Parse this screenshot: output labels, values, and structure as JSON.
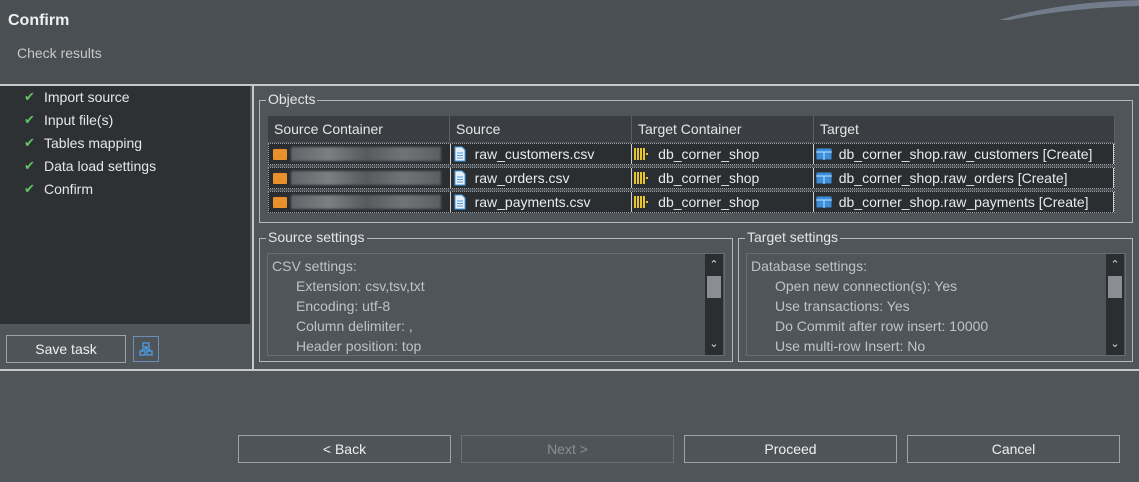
{
  "header": {
    "title": "Confirm",
    "subtitle": "Check results"
  },
  "sidebar": {
    "steps": [
      {
        "label": "Import source"
      },
      {
        "label": "Input file(s)"
      },
      {
        "label": "Tables mapping"
      },
      {
        "label": "Data load settings"
      },
      {
        "label": "Confirm"
      }
    ],
    "save_task_label": "Save task"
  },
  "objects": {
    "title": "Objects",
    "columns": [
      "Source Container",
      "Source",
      "Target Container",
      "Target"
    ],
    "rows": [
      {
        "source": "raw_customers.csv",
        "target_container": "db_corner_shop",
        "target": "db_corner_shop.raw_customers [Create]"
      },
      {
        "source": "raw_orders.csv",
        "target_container": "db_corner_shop",
        "target": "db_corner_shop.raw_orders [Create]"
      },
      {
        "source": "raw_payments.csv",
        "target_container": "db_corner_shop",
        "target": "db_corner_shop.raw_payments [Create]"
      }
    ]
  },
  "source_settings": {
    "title": "Source settings",
    "lines": [
      "CSV settings:",
      "Extension: csv,tsv,txt",
      "Encoding: utf-8",
      "Column delimiter: ,",
      "Header position: top"
    ]
  },
  "target_settings": {
    "title": "Target settings",
    "lines": [
      "Database settings:",
      "Open new connection(s): Yes",
      "Use transactions: Yes",
      "Do Commit after row insert: 10000",
      "Use multi-row Insert: No"
    ]
  },
  "footer": {
    "back_label": "< Back",
    "next_label": "Next >",
    "proceed_label": "Proceed",
    "cancel_label": "Cancel"
  },
  "colors": {
    "accent_check": "#62c462",
    "folder_icon": "#e8902c",
    "db_icon": "#e6c42a",
    "table_icon": "#3a8fd8"
  }
}
